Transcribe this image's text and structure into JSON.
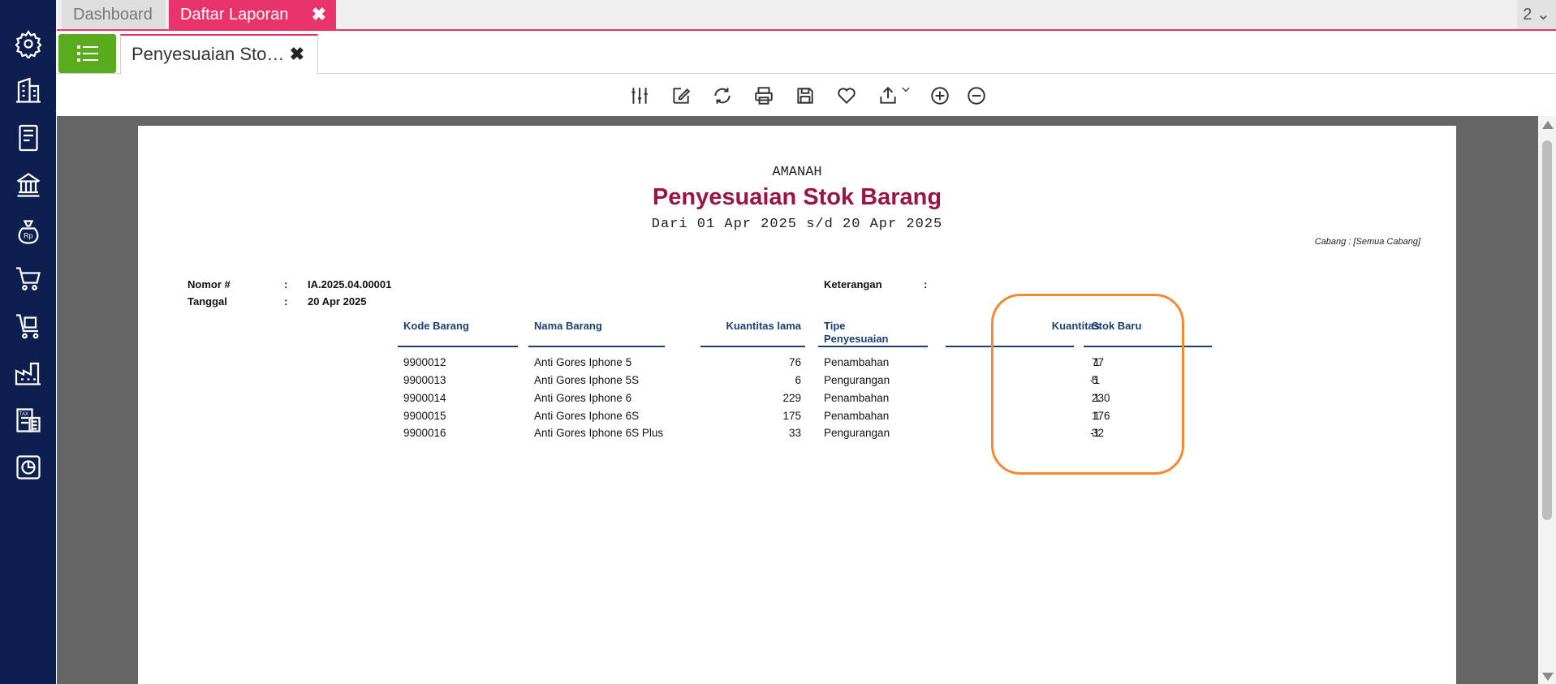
{
  "tabs": {
    "dashboard": "Dashboard",
    "daftar_laporan": "Daftar Laporan",
    "close_glyph": "✖",
    "counter": "2 ⌄"
  },
  "report_tab": {
    "label": "Penyesuaian Sto…",
    "close_glyph": "✖"
  },
  "sidebar_icons": [
    "gear-icon",
    "building-icon",
    "book-icon",
    "bank-icon",
    "money-bag-icon",
    "cart-icon",
    "cart-box-icon",
    "factory-icon",
    "tax-icon",
    "pie-chart-icon"
  ],
  "toolbar_icons": [
    "sliders-icon",
    "edit-icon",
    "refresh-icon",
    "print-icon",
    "save-icon",
    "heart-icon",
    "export-icon",
    "zoom-in-icon",
    "zoom-out-icon"
  ],
  "report": {
    "company": "AMANAH",
    "title": "Penyesuaian Stok Barang",
    "period": "Dari 01 Apr 2025 s/d 20 Apr 2025",
    "branch": "Cabang : [Semua Cabang]",
    "meta": {
      "nomor_label": "Nomor #",
      "nomor_value": "IA.2025.04.00001",
      "tanggal_label": "Tanggal",
      "tanggal_value": "20 Apr 2025",
      "keterangan_label": "Keterangan",
      "colon": ":"
    },
    "columns": {
      "kode": "Kode Barang",
      "nama": "Nama Barang",
      "qty_lama": "Kuantitas lama",
      "tipe_1": "Tipe",
      "tipe_2": "Penyesuaian",
      "qty": "Kuantitas",
      "stok_baru": "Stok Baru"
    },
    "rows": [
      {
        "kode": "9900012",
        "nama": "Anti Gores Iphone 5",
        "qty_lama": "76",
        "tipe": "Penambahan",
        "qty": "1",
        "stok_baru": "77"
      },
      {
        "kode": "9900013",
        "nama": "Anti Gores Iphone 5S",
        "qty_lama": "6",
        "tipe": "Pengurangan",
        "qty": "-1",
        "stok_baru": "5"
      },
      {
        "kode": "9900014",
        "nama": "Anti Gores Iphone 6",
        "qty_lama": "229",
        "tipe": "Penambahan",
        "qty": "1",
        "stok_baru": "230"
      },
      {
        "kode": "9900015",
        "nama": "Anti Gores Iphone 6S",
        "qty_lama": "175",
        "tipe": "Penambahan",
        "qty": "1",
        "stok_baru": "176"
      },
      {
        "kode": "9900016",
        "nama": "Anti Gores Iphone 6S Plus",
        "qty_lama": "33",
        "tipe": "Pengurangan",
        "qty": "-1",
        "stok_baru": "32"
      }
    ]
  },
  "colors": {
    "sidebar": "#0d1f4f",
    "accent_pink": "#e8336b",
    "menu_green": "#5aaa1e",
    "title_red": "#9b1543",
    "header_blue": "#1c3e73",
    "highlight_orange": "#f28a2e"
  }
}
